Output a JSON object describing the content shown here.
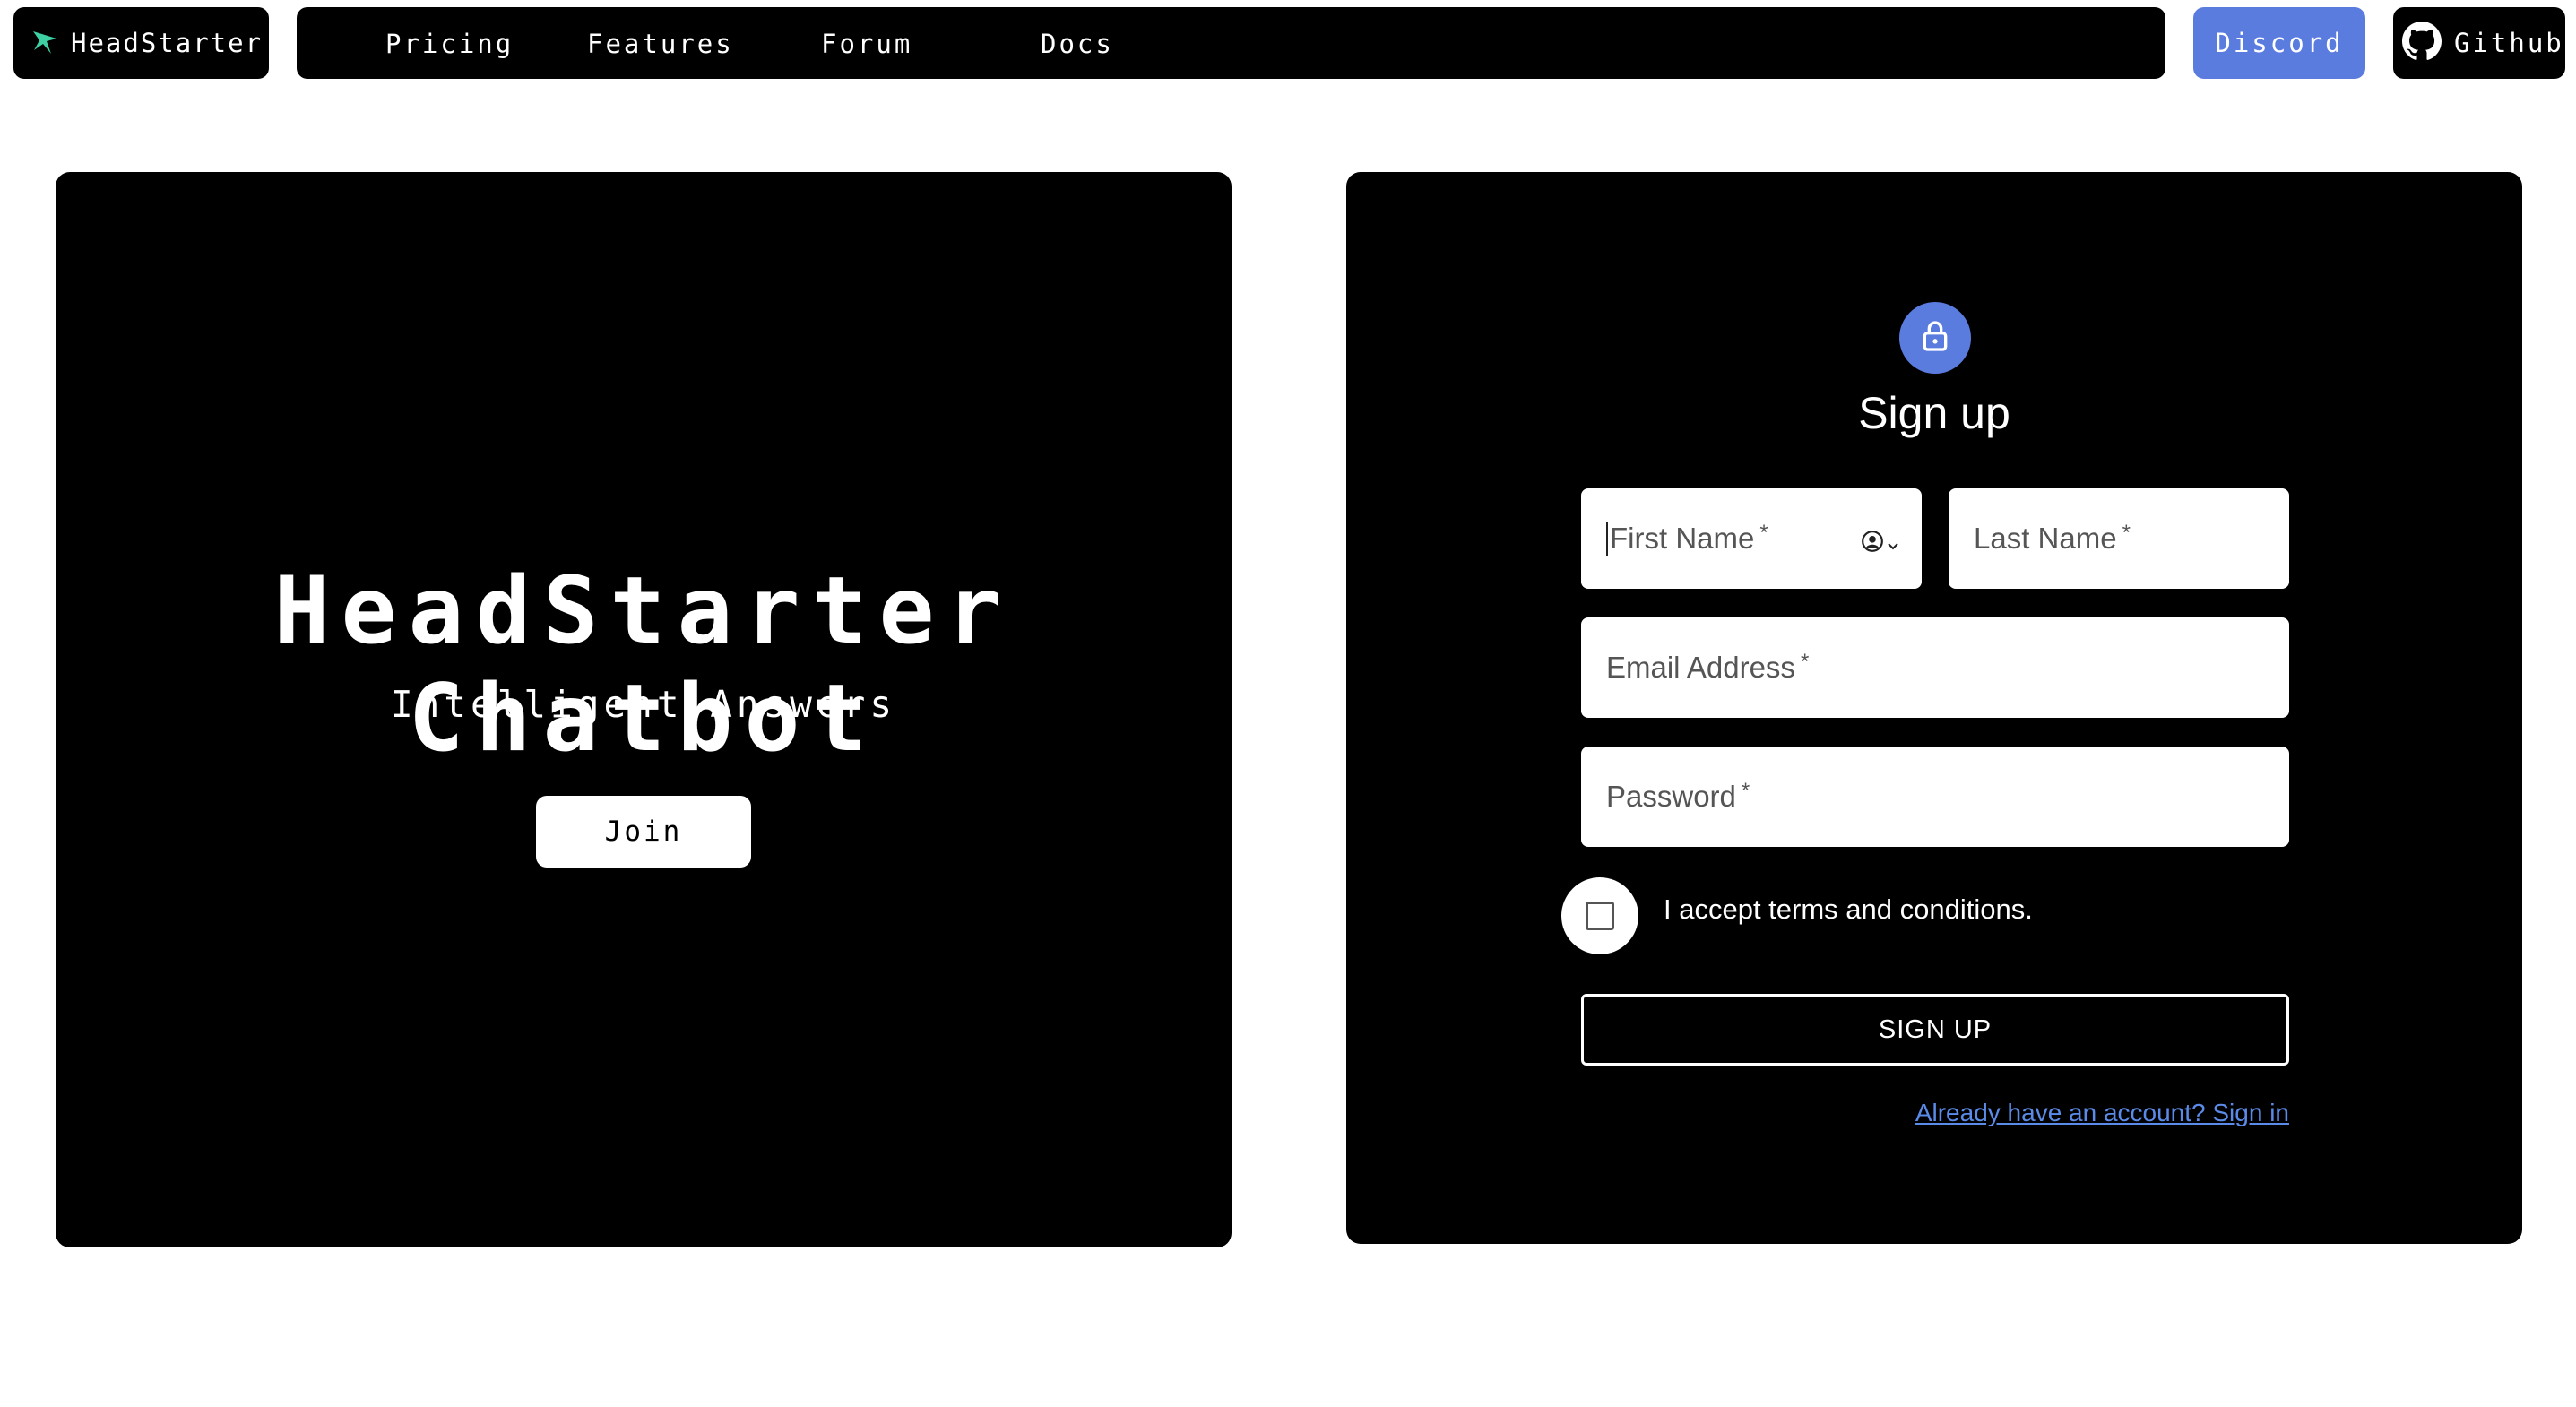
{
  "nav": {
    "brand": "HeadStarter",
    "menu": [
      "Pricing",
      "Features",
      "Forum",
      "Docs"
    ],
    "discord": "Discord",
    "github": "Github"
  },
  "hero": {
    "title": "HeadStarter Chatbot",
    "subtitle": "Intelligent Answers",
    "join": "Join"
  },
  "signup": {
    "title": "Sign up",
    "first_name": "First Name",
    "last_name": "Last Name",
    "email": "Email Address",
    "password": "Password",
    "required_mark": "*",
    "terms": "I accept terms and conditions.",
    "button": "SIGN UP",
    "signin_link": "Already have an account? Sign in"
  },
  "colors": {
    "accent": "#5b7cdf",
    "link": "#5b8be8",
    "panel": "#000000",
    "background": "#ffffff"
  },
  "icons": [
    "star-logo-icon",
    "github-icon",
    "lock-icon",
    "contact-autofill-icon",
    "chevron-down-icon"
  ]
}
